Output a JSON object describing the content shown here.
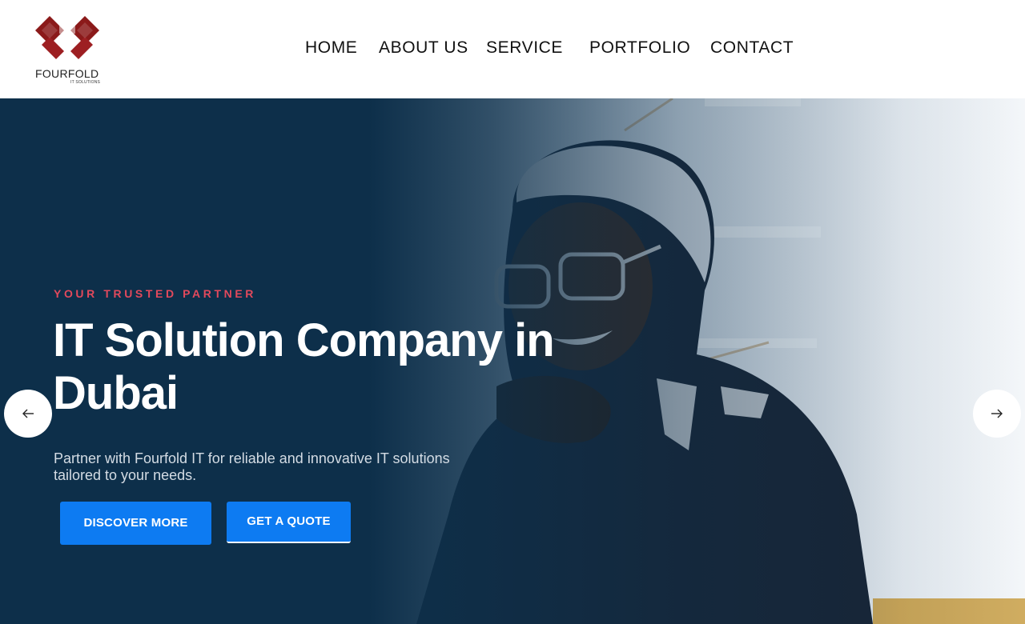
{
  "brand": {
    "name": "FOURFOLD",
    "tagline": "IT SOLUTIONS",
    "logo_color": "#8b1a1a"
  },
  "nav": {
    "items": [
      {
        "label": "HOME"
      },
      {
        "label": "ABOUT US"
      },
      {
        "label": "SERVICE"
      },
      {
        "label": "PORTFOLIO"
      },
      {
        "label": "CONTACT"
      }
    ]
  },
  "hero": {
    "eyebrow": "YOUR TRUSTED PARTNER",
    "title_line1": "IT Solution Company in",
    "title_line2": "Dubai",
    "description_line1": "Partner with Fourfold IT for reliable and innovative IT solutions",
    "description_line2": "tailored to your needs.",
    "primary_button": "DISCOVER MORE",
    "secondary_button": "GET A QUOTE",
    "prev_icon": "arrow-left-icon",
    "next_icon": "arrow-right-icon",
    "eyebrow_color": "#e2495c",
    "button_color": "#0d7bf2",
    "overlay_color": "#0d2f4a"
  }
}
